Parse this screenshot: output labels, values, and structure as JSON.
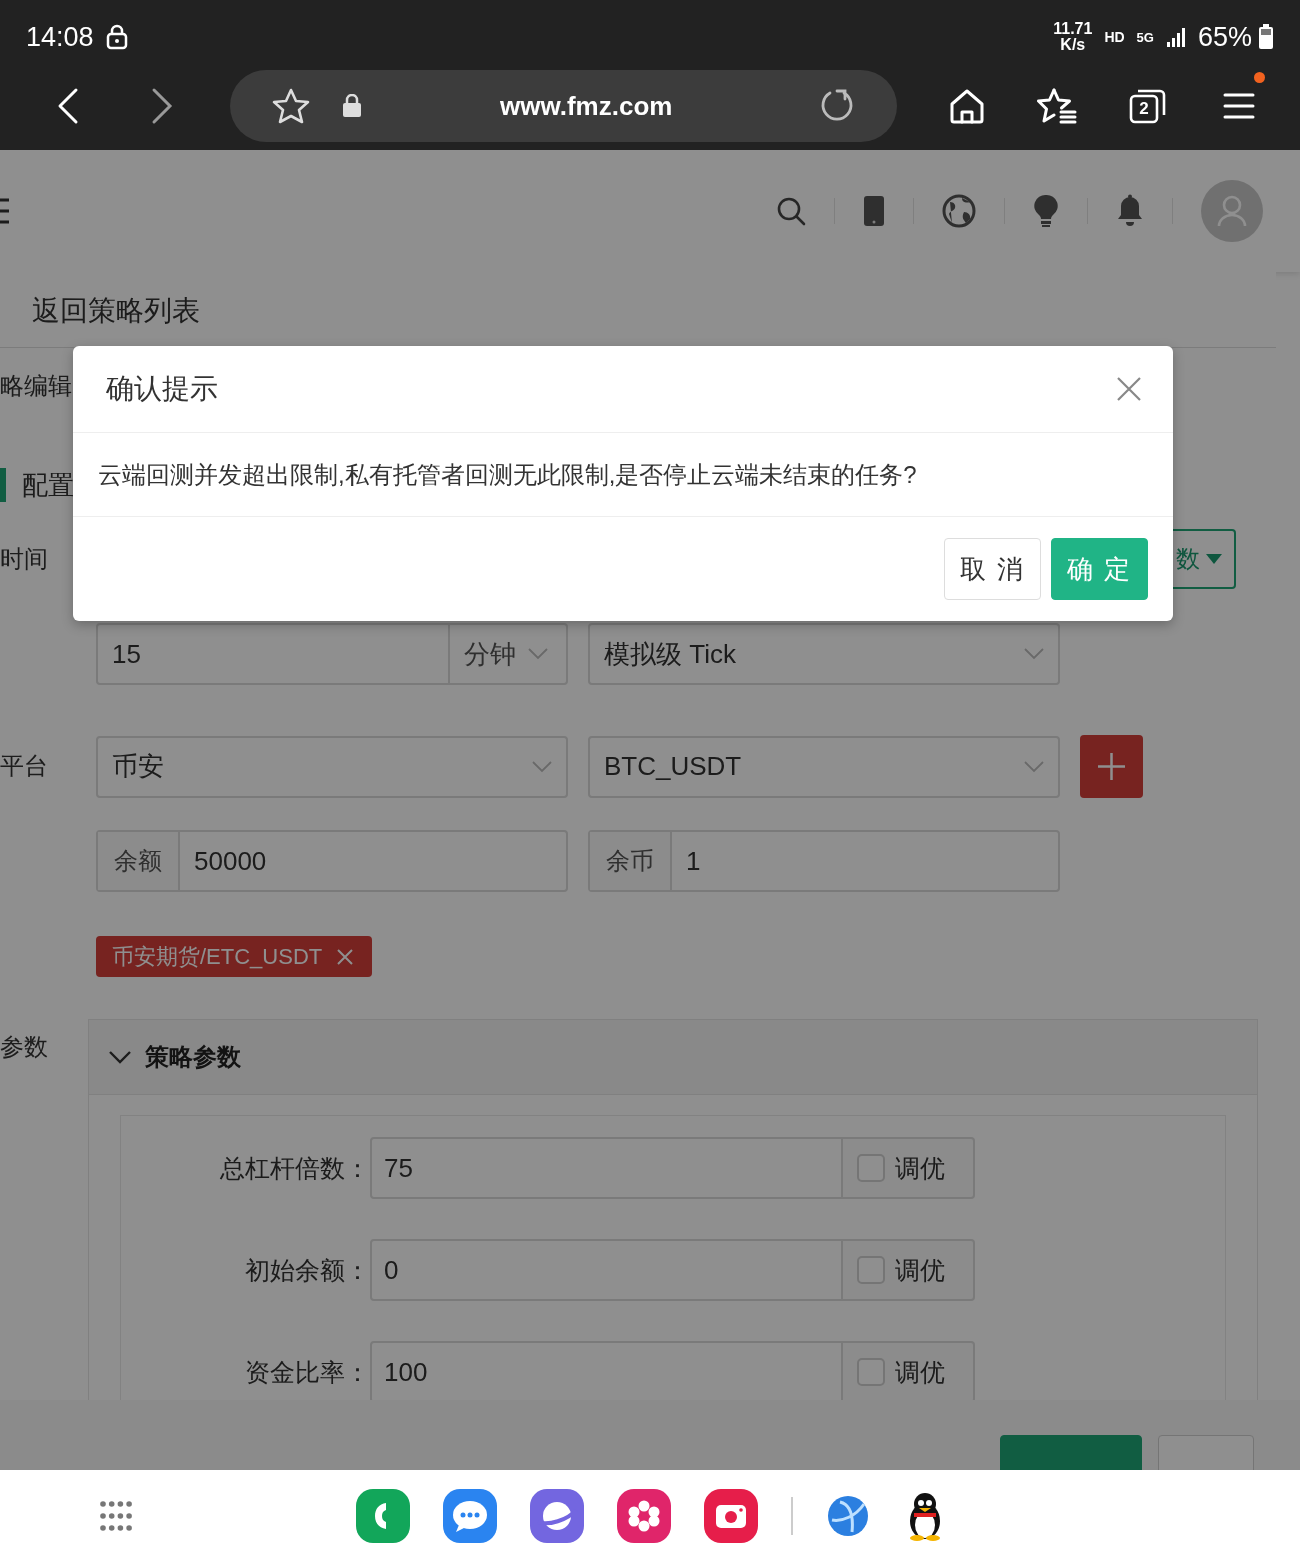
{
  "status_bar": {
    "time": "14:08",
    "network_speed": "11.71",
    "speed_unit": "K/s",
    "hd": "HD",
    "network": "5G",
    "battery": "65%"
  },
  "browser": {
    "url": "www.fmz.com",
    "tab_count": "2",
    "menu_badge": true
  },
  "back_link": "返回策略列表",
  "tab": "略编辑",
  "section_title": "配置",
  "time_label": "时间",
  "dropdown_button": "数",
  "period": {
    "value": "15",
    "unit": "分钟"
  },
  "mode": "模拟级 Tick",
  "platform_label": "平台",
  "exchange": "币安",
  "pair": "BTC_USDT",
  "balance": {
    "label": "余额",
    "value": "50000"
  },
  "coins": {
    "label": "余币",
    "value": "1"
  },
  "tags": [
    {
      "label": "币安期货/ETC_USDT"
    }
  ],
  "params_label": "参数",
  "params": {
    "title": "策略参数",
    "expanded": true,
    "rows": [
      {
        "label": "总杠杆倍数：",
        "value": "75",
        "tune_label": "调优",
        "checked": false
      },
      {
        "label": "初始余额：",
        "value": "0",
        "tune_label": "调优",
        "checked": false
      },
      {
        "label": "资金比率：",
        "value": "100",
        "tune_label": "调优",
        "checked": false
      }
    ]
  },
  "dialog": {
    "title": "确认提示",
    "message": "云端回测并发超出限制,私有托管者回测无此限制,是否停止云端未结束的任务?",
    "buttons": [
      {
        "label": "取 消",
        "kind": "default"
      },
      {
        "label": "确 定",
        "kind": "primary"
      }
    ]
  }
}
